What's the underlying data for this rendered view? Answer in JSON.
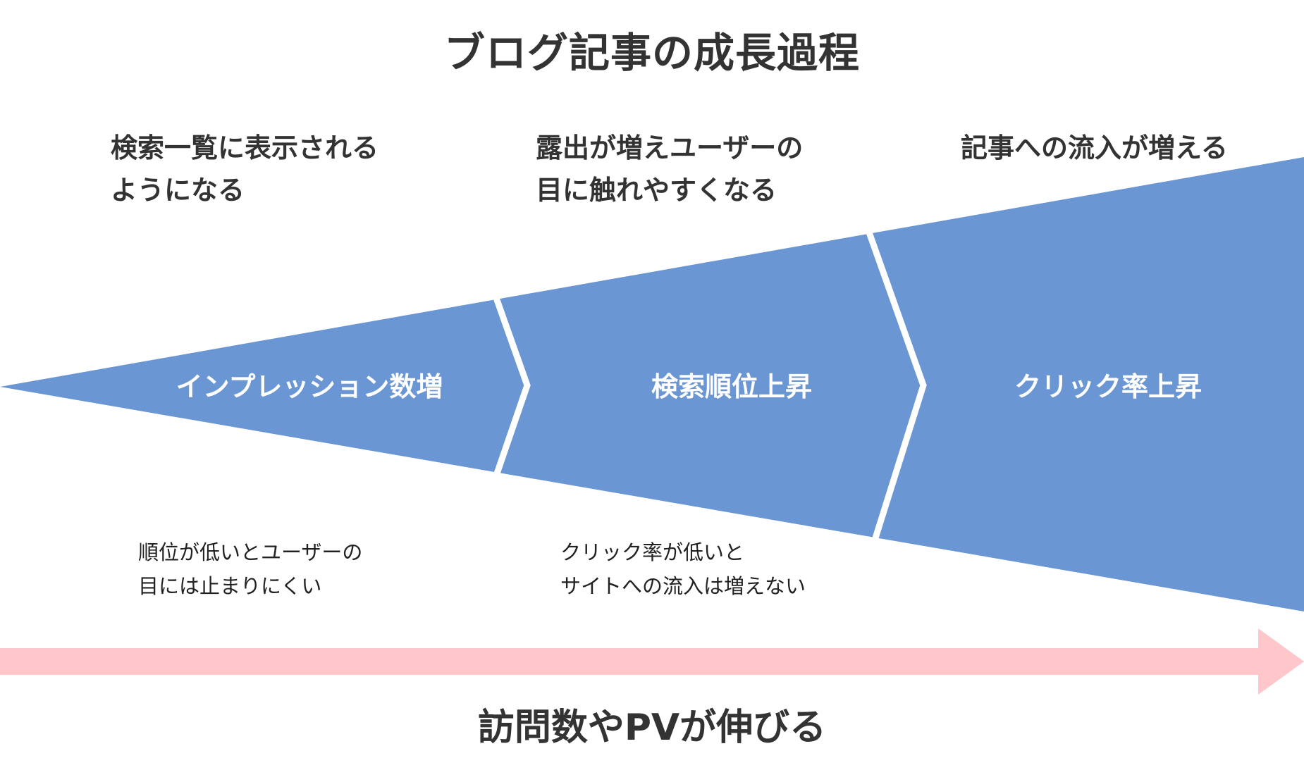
{
  "title": "ブログ記事の成長過程",
  "colors": {
    "funnel": "#6b96d4",
    "divider": "#ffffff",
    "arrow": "#ffc7c9",
    "text": "#333333"
  },
  "stages": [
    {
      "label": "インプレッション数増",
      "top_lines": [
        "検索一覧に表示される",
        "ようになる"
      ]
    },
    {
      "label": "検索順位上昇",
      "top_lines": [
        "露出が増えユーザーの",
        "目に触れやすくなる"
      ]
    },
    {
      "label": "クリック率上昇",
      "top_lines": [
        "記事への流入が増える"
      ]
    }
  ],
  "bottom_notes": [
    {
      "lines": [
        "順位が低いとユーザーの",
        "目には止まりにくい"
      ]
    },
    {
      "lines": [
        "クリック率が低いと",
        "サイトへの流入は増えない"
      ]
    }
  ],
  "arrow_caption": "訪問数やPVが伸びる"
}
